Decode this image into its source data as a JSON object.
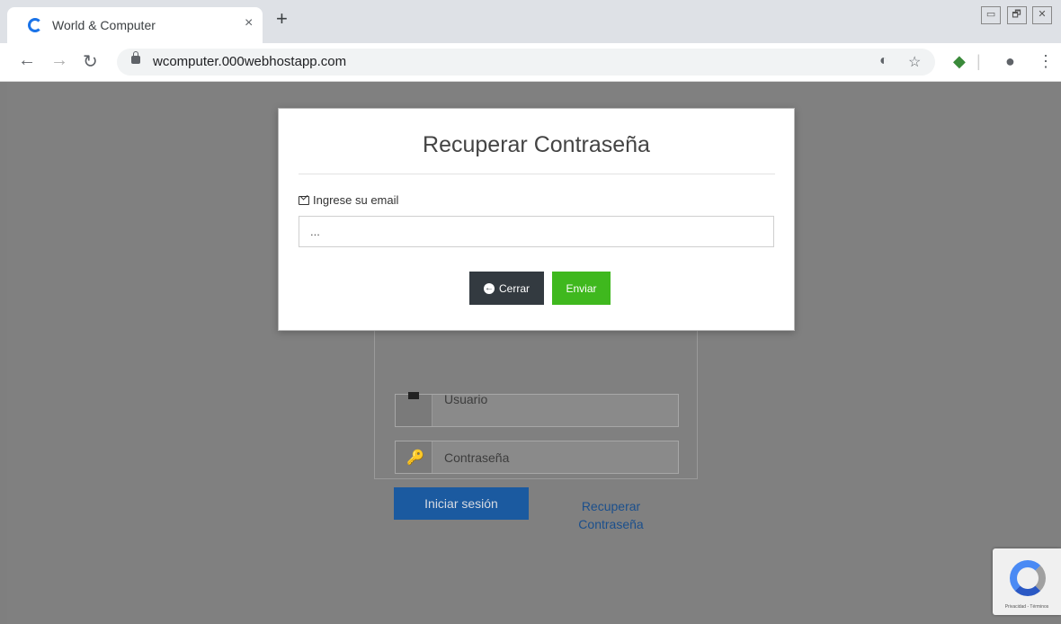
{
  "browser": {
    "tab_title": "World & Computer",
    "tab_close": "×",
    "new_tab": "+",
    "url": "wcomputer.000webhostapp.com",
    "window_buttons": [
      "▭",
      "🗗",
      "✕"
    ]
  },
  "modal": {
    "title": "Recuperar Contraseña",
    "email_label": "Ingrese su email",
    "email_placeholder": "...",
    "close_label": "Cerrar",
    "send_label": "Enviar"
  },
  "login": {
    "user_placeholder": "Usuario",
    "password_placeholder": "Contraseña",
    "login_button": "Iniciar sesión",
    "recover_link": "Recuperar Contraseña"
  },
  "recaptcha": {
    "footer": "Privacidad - Términos"
  },
  "colors": {
    "send": "#3fb81e",
    "close": "#333a40",
    "login": "#1b5aa0",
    "link": "#1b4f8c"
  }
}
